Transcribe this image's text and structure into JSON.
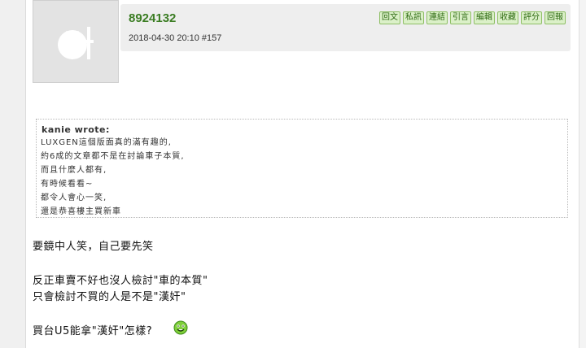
{
  "post": {
    "username": "8924132",
    "timestamp": "2018-04-30 20:10  #157",
    "actions": [
      "回文",
      "私訊",
      "連結",
      "引言",
      "編輯",
      "收藏",
      "評分",
      "回報"
    ]
  },
  "quote": {
    "author": "kanie wrote:",
    "lines": [
      "LUXGEN這個版面真的滿有趣的,",
      "約6成的文章都不是在討論車子本質,",
      "而且什麼人都有,",
      "有時候看看~",
      "都令人會心一笑,",
      "還是恭喜樓主買新車"
    ]
  },
  "message": {
    "lines": [
      "要鏡中人笑，自己要先笑",
      "反正車賣不好也沒人檢討\"車的本質\"",
      "只會檢討不買的人是不是\"漢奸\"",
      "買台U5能拿\"漢奸\"怎樣?"
    ],
    "emoji": "smiley-icon"
  }
}
